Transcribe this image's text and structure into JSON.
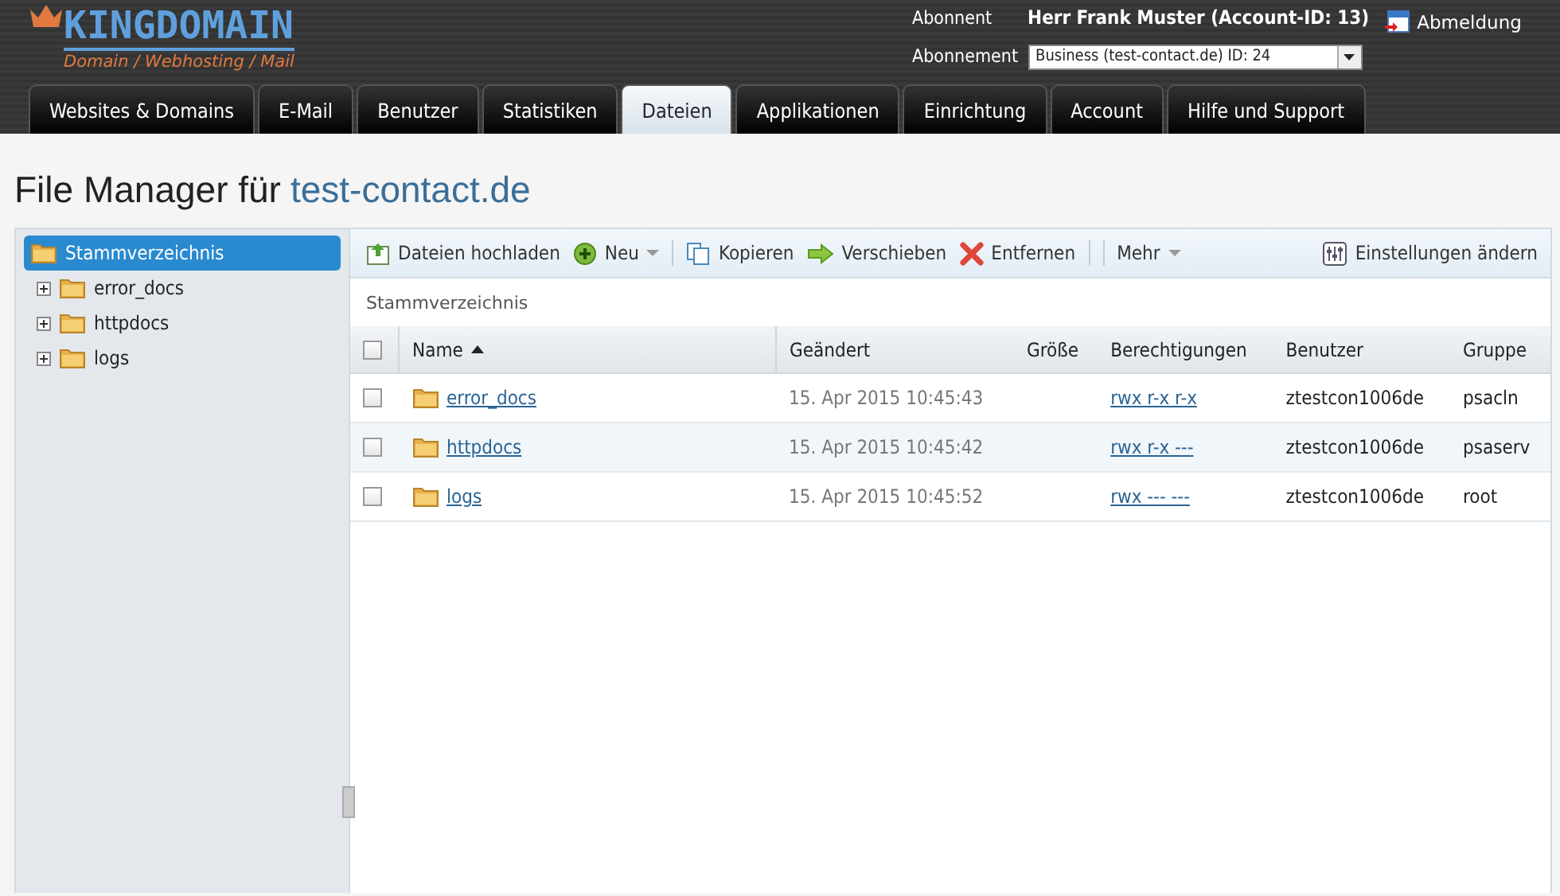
{
  "logo": {
    "name": "KINGDOMAIN",
    "tagline": "Domain / Webhosting / Mail"
  },
  "account": {
    "subscriber_label": "Abonnent",
    "subscriber": "Herr Frank Muster (Account-ID: 13)",
    "subscription_label": "Abonnement",
    "subscription": "Business (test-contact.de) ID: 24",
    "logout": "Abmeldung"
  },
  "tabs": [
    {
      "label": "Websites & Domains",
      "selected": false
    },
    {
      "label": "E-Mail",
      "selected": false
    },
    {
      "label": "Benutzer",
      "selected": false
    },
    {
      "label": "Statistiken",
      "selected": false
    },
    {
      "label": "Dateien",
      "selected": true
    },
    {
      "label": "Applikationen",
      "selected": false
    },
    {
      "label": "Einrichtung",
      "selected": false
    },
    {
      "label": "Account",
      "selected": false
    },
    {
      "label": "Hilfe und Support",
      "selected": false
    }
  ],
  "page_title": {
    "text": "File Manager für",
    "domain": "test-contact.de"
  },
  "tree": {
    "root": {
      "label": "Stammverzeichnis",
      "selected": true
    },
    "children": [
      {
        "label": "error_docs",
        "selected": false
      },
      {
        "label": "httpdocs",
        "selected": false
      },
      {
        "label": "logs",
        "selected": false
      }
    ]
  },
  "toolbar": [
    {
      "kind": "upload",
      "label": "Dateien hochladen",
      "dropdown": false
    },
    {
      "kind": "new",
      "label": "Neu",
      "dropdown": true
    },
    {
      "kind": "copy",
      "label": "Kopieren",
      "dropdown": false
    },
    {
      "kind": "move",
      "label": "Verschieben",
      "dropdown": false
    },
    {
      "kind": "delete",
      "label": "Entfernen",
      "dropdown": false
    },
    {
      "kind": "more",
      "label": "Mehr",
      "dropdown": true
    },
    {
      "kind": "settings",
      "label": "Einstellungen ändern",
      "dropdown": false
    }
  ],
  "breadcrumb": "Stammverzeichnis",
  "table": {
    "select_all_checked": false,
    "columns": [
      "Name",
      "Geändert",
      "Größe",
      "Berechtigungen",
      "Benutzer",
      "Gruppe"
    ],
    "rows": [
      {
        "checked": false,
        "name": "error_docs",
        "modified": "15. Apr 2015 10:45:43",
        "permissions": "rwx r-x r-x",
        "user": "ztestcon1006de",
        "group": "psacln"
      },
      {
        "checked": false,
        "name": "httpdocs",
        "modified": "15. Apr 2015 10:45:42",
        "permissions": "rwx r-x ---",
        "user": "ztestcon1006de",
        "group": "psaserv"
      },
      {
        "checked": false,
        "name": "logs",
        "modified": "15. Apr 2015 10:45:52",
        "permissions": "rwx --- ---",
        "user": "ztestcon1006de",
        "group": "root"
      }
    ]
  }
}
